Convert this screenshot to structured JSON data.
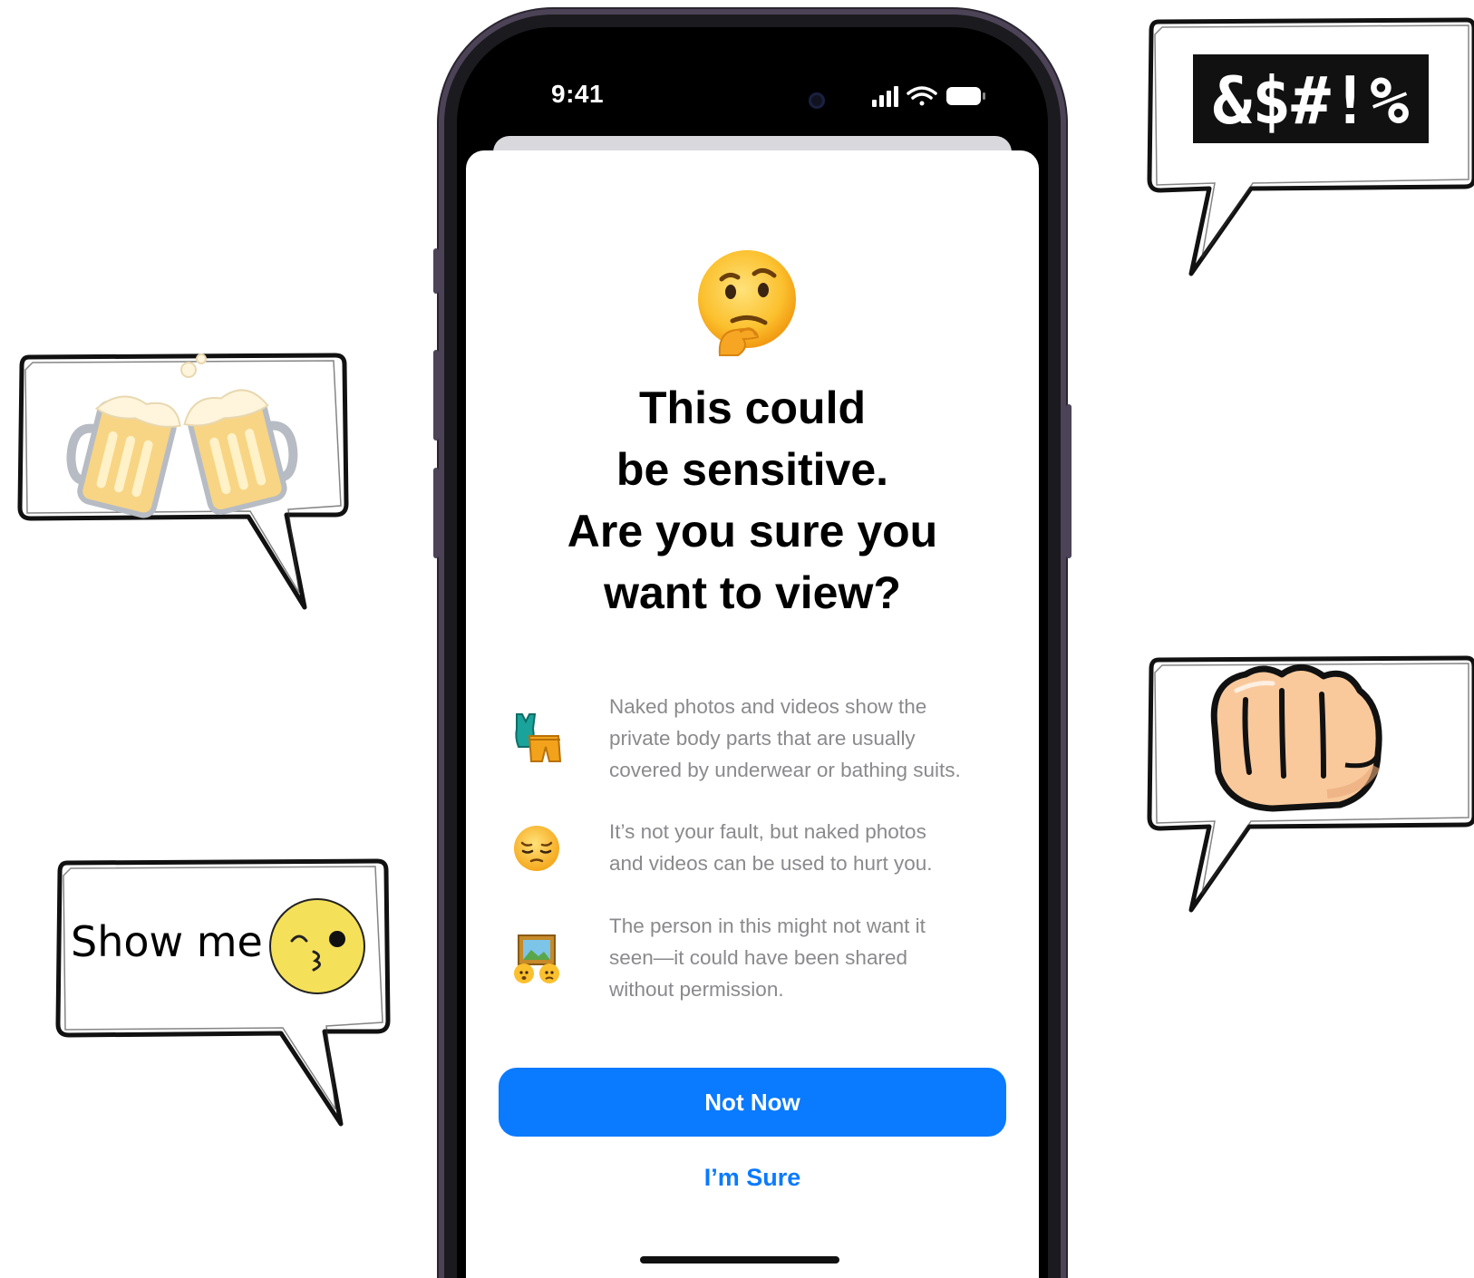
{
  "status_bar": {
    "time": "9:41",
    "icons": [
      "signal-icon",
      "wifi-icon",
      "battery-icon"
    ]
  },
  "sheet": {
    "emoji": "thinking-face-icon",
    "title_lines": [
      "This could",
      "be sensitive.",
      "Are you sure you",
      "want to view?"
    ],
    "items": [
      {
        "icon": "swimsuit-icon",
        "lines": [
          "Naked photos and videos show the",
          "private body parts that are usually",
          "covered by underwear or bathing suits."
        ]
      },
      {
        "icon": "pensive-face-icon",
        "lines": [
          "It’s not your fault, but naked photos",
          "and videos can be used to hurt you."
        ]
      },
      {
        "icon": "framed-picture-icon",
        "lines": [
          "The person in this might not want it",
          "seen—it could have been shared",
          "without permission."
        ]
      }
    ],
    "primary_button": "Not Now",
    "secondary_button": "I’m Sure"
  },
  "bubbles": {
    "top_right_text": "&$#!%",
    "bottom_left_text": "Show me",
    "icons": [
      "beer-mugs-icon",
      "fist-icon",
      "kissing-face-icon"
    ]
  },
  "colors": {
    "accent": "#0a7aff",
    "frame": "#4c4357",
    "secondary_text": "#8a8a8e"
  }
}
